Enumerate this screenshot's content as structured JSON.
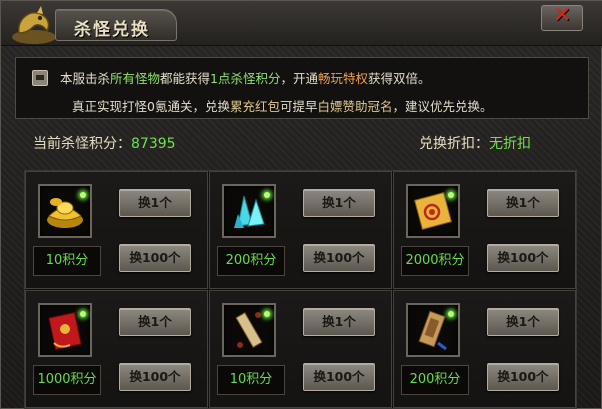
{
  "window": {
    "title": "杀怪兑换",
    "close_label": "✕"
  },
  "info": {
    "line1": [
      {
        "t": "本服击杀",
        "c": ""
      },
      {
        "t": "所有怪物",
        "c": "gr"
      },
      {
        "t": "都能获得",
        "c": ""
      },
      {
        "t": "1点杀怪积分",
        "c": "gr"
      },
      {
        "t": "，开通",
        "c": ""
      },
      {
        "t": "畅玩特权",
        "c": "or"
      },
      {
        "t": "获得双倍。",
        "c": ""
      }
    ],
    "line2": [
      {
        "t": "真正实现打怪0氪通关，兑换",
        "c": ""
      },
      {
        "t": "累充红包",
        "c": "hl"
      },
      {
        "t": "可提早",
        "c": ""
      },
      {
        "t": "白嫖赞助冠名",
        "c": "hl"
      },
      {
        "t": "，建议优先兑换。",
        "c": ""
      }
    ]
  },
  "status": {
    "points_label": "当前杀怪积分：",
    "points_value": "87395",
    "discount_label": "兑换折扣：",
    "discount_value": "无折扣"
  },
  "items": [
    {
      "name": "gold-ingot",
      "icon": "gold-ingot-icon",
      "cost": "10积分",
      "btn1": "换1个",
      "btn100": "换100个"
    },
    {
      "name": "blue-crystal",
      "icon": "crystal-icon",
      "cost": "200积分",
      "btn1": "换1个",
      "btn100": "换100个"
    },
    {
      "name": "gold-talisman",
      "icon": "talisman-icon",
      "cost": "2000积分",
      "btn1": "换1个",
      "btn100": "换100个"
    },
    {
      "name": "red-envelope",
      "icon": "red-envelope-icon",
      "cost": "1000积分",
      "btn1": "换1个",
      "btn100": "换100个"
    },
    {
      "name": "scroll",
      "icon": "scroll-icon",
      "cost": "10积分",
      "btn1": "换1个",
      "btn100": "换100个"
    },
    {
      "name": "token",
      "icon": "token-icon",
      "cost": "200积分",
      "btn1": "换1个",
      "btn100": "换100个"
    }
  ],
  "colors": {
    "accent_green": "#6fe24c",
    "accent_orange": "#f0a044",
    "close_red": "#d8261c"
  }
}
